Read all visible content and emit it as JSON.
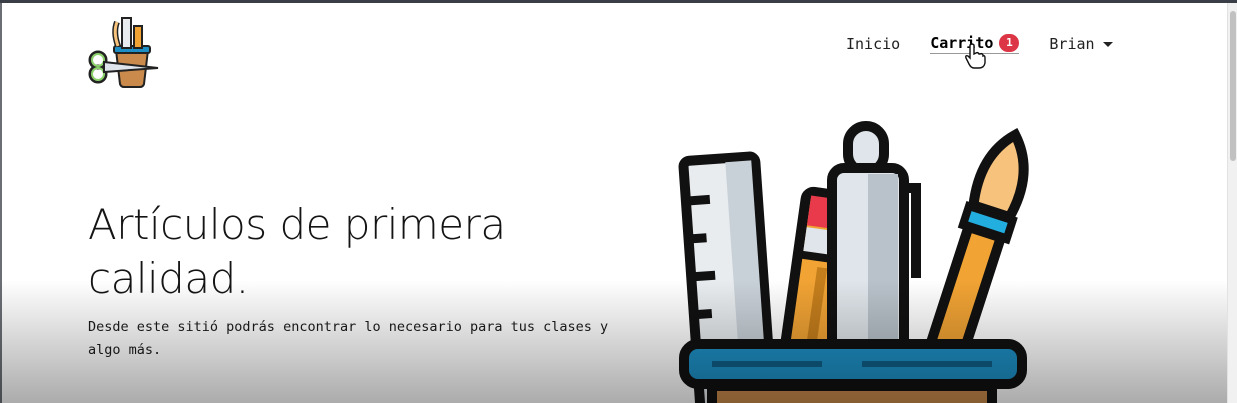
{
  "navbar": {
    "logo_name": "stationery-logo",
    "items": [
      {
        "label": "Inicio"
      },
      {
        "label": "Carrito",
        "badge": "1"
      },
      {
        "label": "Brian"
      }
    ]
  },
  "hero": {
    "title": "Artículos de primera calidad.",
    "description": "Desde este sitió podrás encontrar lo necesario para tus clases y algo más."
  },
  "colors": {
    "badge": "#dc3545",
    "accent_blue": "#1d8fc4",
    "pencil_orange": "#f1a334"
  }
}
